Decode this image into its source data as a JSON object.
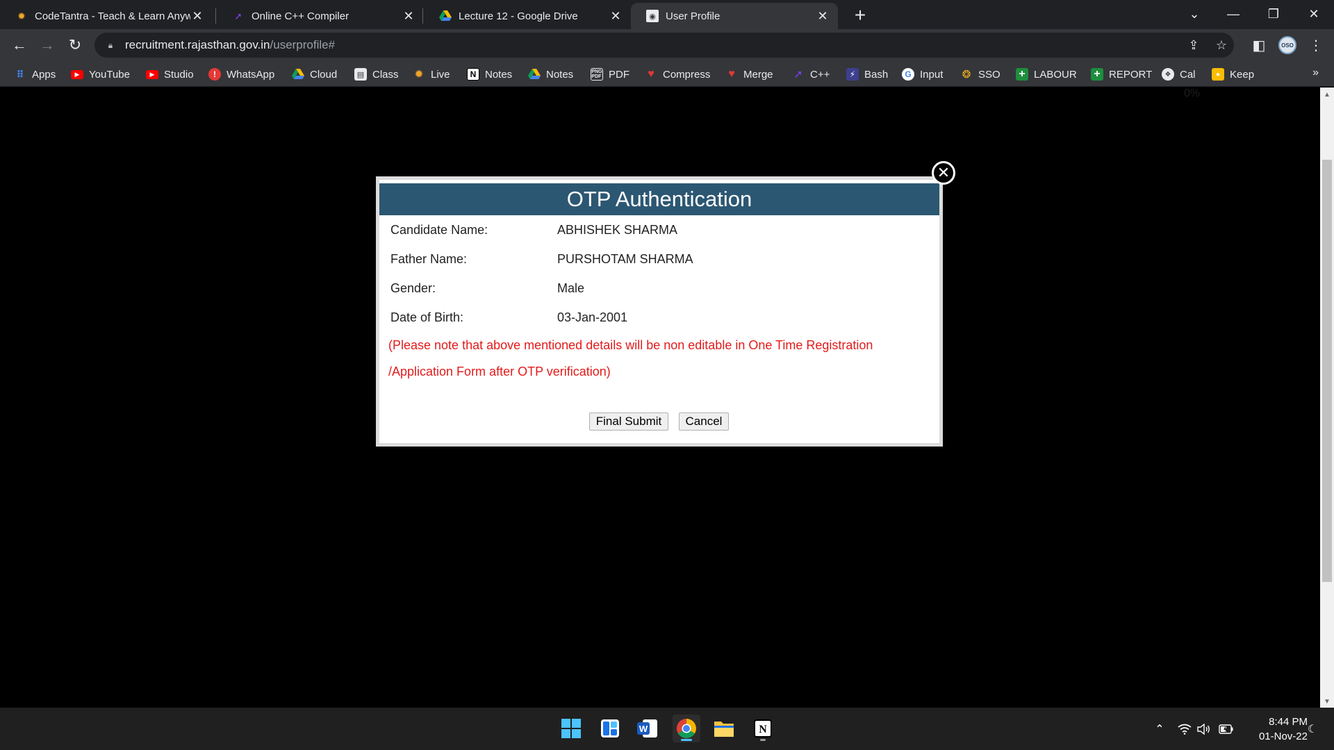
{
  "browser": {
    "tabs": [
      {
        "title": "CodeTantra - Teach & Learn Anyw",
        "icon": "codetantra-icon",
        "active": false
      },
      {
        "title": "Online C++ Compiler",
        "icon": "programiz-icon",
        "active": false
      },
      {
        "title": "Lecture 12 - Google Drive",
        "icon": "google-drive-icon",
        "active": false
      },
      {
        "title": "User Profile",
        "icon": "user-profile-icon",
        "active": true
      }
    ],
    "new_tab_label": "+",
    "url": {
      "host": "recruitment.rajasthan.gov.in",
      "path": "/userprofile#"
    },
    "avatar_text": "OSO"
  },
  "bookmarks": [
    {
      "label": "Apps",
      "icon": "apps-grid-icon"
    },
    {
      "label": "YouTube",
      "icon": "youtube-icon"
    },
    {
      "label": "Studio",
      "icon": "youtube-studio-icon"
    },
    {
      "label": "WhatsApp",
      "icon": "whatsapp-icon"
    },
    {
      "label": "Cloud",
      "icon": "google-drive-icon"
    },
    {
      "label": "Class",
      "icon": "document-icon"
    },
    {
      "label": "Live",
      "icon": "codetantra-icon"
    },
    {
      "label": "Notes",
      "icon": "notion-icon"
    },
    {
      "label": "Notes",
      "icon": "google-drive-icon"
    },
    {
      "label": "PDF",
      "icon": "png-pdf-icon"
    },
    {
      "label": "Compress",
      "icon": "heart-icon"
    },
    {
      "label": "Merge",
      "icon": "heart-icon"
    },
    {
      "label": "C++",
      "icon": "programiz-icon"
    },
    {
      "label": "Bash",
      "icon": "bolt-icon"
    },
    {
      "label": "Input",
      "icon": "google-icon"
    },
    {
      "label": "SSO",
      "icon": "sso-icon"
    },
    {
      "label": "LABOUR",
      "icon": "plus-green-icon"
    },
    {
      "label": "REPORT",
      "icon": "plus-green-icon"
    },
    {
      "label": "Cal",
      "icon": "calendar-icon"
    },
    {
      "label": "Keep",
      "icon": "google-keep-icon"
    }
  ],
  "bookmarks_overflow": "»",
  "page": {
    "progress_text": "0%"
  },
  "modal": {
    "title": "OTP Authentication",
    "fields": [
      {
        "label": "Candidate Name:",
        "value": "ABHISHEK SHARMA"
      },
      {
        "label": "Father Name:",
        "value": "PURSHOTAM SHARMA"
      },
      {
        "label": "Gender:",
        "value": "Male"
      },
      {
        "label": "Date of Birth:",
        "value": "03-Jan-2001"
      }
    ],
    "note_line1": "(Please note that above mentioned details will be non editable in One Time Registration",
    "note_line2": "/Application Form after OTP verification)",
    "submit_label": "Final Submit",
    "cancel_label": "Cancel"
  },
  "taskbar": {
    "apps": [
      "windows-start-icon",
      "widgets-icon",
      "word-icon",
      "chrome-icon",
      "file-explorer-icon",
      "notion-icon"
    ],
    "time": "8:44 PM",
    "date": "01-Nov-22"
  },
  "colors": {
    "modal_header": "#2c5772",
    "note_text": "#e31b1b",
    "tab_active": "#35363a",
    "tabstrip": "#202124"
  }
}
